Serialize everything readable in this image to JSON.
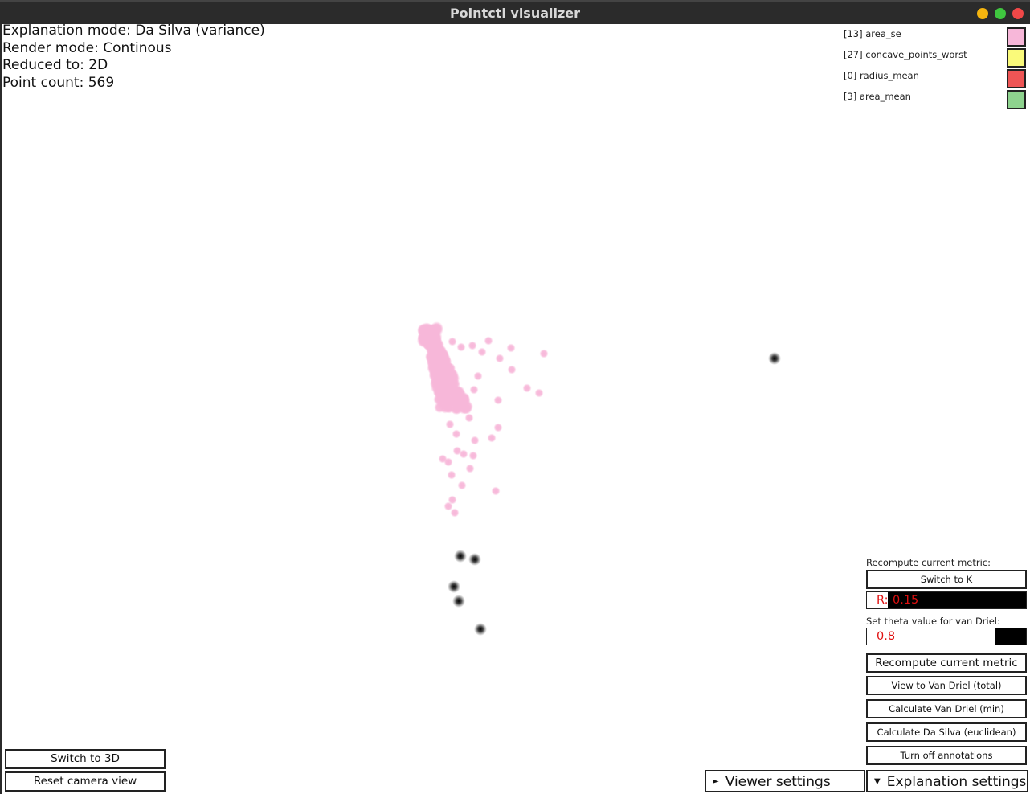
{
  "window": {
    "title": "Pointctl visualizer"
  },
  "status": {
    "explanation_mode": "Explanation mode: Da Silva (variance)",
    "render_mode": "Render mode: Continous",
    "reduced_to": "Reduced to: 2D",
    "point_count": "Point count: 569"
  },
  "legend": [
    {
      "label": "[13] area_se",
      "color": "#f7b7d9"
    },
    {
      "label": "[27] concave_points_worst",
      "color": "#fafa7a"
    },
    {
      "label": "[0] radius_mean",
      "color": "#ee5555"
    },
    {
      "label": "[3] area_mean",
      "color": "#8ed38e"
    }
  ],
  "panel": {
    "recompute_caption": "Recompute current metric:",
    "switch_k": "Switch to K",
    "r_label": "R:",
    "r_value": "0.15",
    "theta_caption": "Set theta value for van Driel:",
    "theta_value": "0.8",
    "recompute_button": "Recompute current metric",
    "view_van_driel": "View to Van Driel (total)",
    "calc_van_driel_min": "Calculate Van Driel (min)",
    "calc_da_silva": "Calculate Da Silva (euclidean)",
    "turn_off_annotations": "Turn off annotations"
  },
  "bottom": {
    "switch_3d": "Switch to 3D",
    "reset_camera": "Reset camera view",
    "viewer_settings": "Viewer settings",
    "explanation_settings": "Explanation settings"
  },
  "colors": {
    "pink_point": "#f7b7d9",
    "dark_point": "#111111",
    "field_text": "#e01010"
  }
}
